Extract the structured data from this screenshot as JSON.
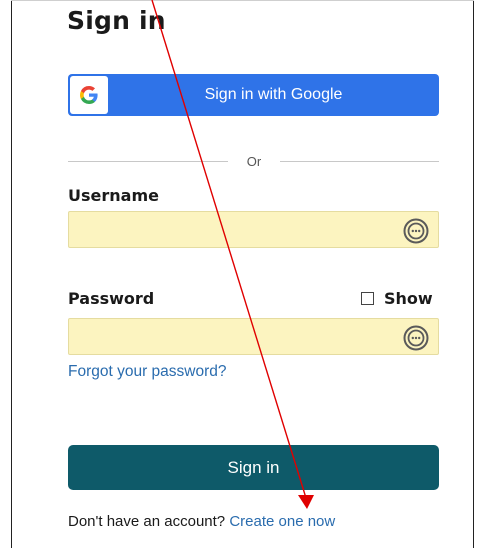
{
  "page": {
    "title": "Sign in"
  },
  "google": {
    "label": "Sign in with Google",
    "brand_color": "#2f73e8"
  },
  "divider": {
    "text": "Or"
  },
  "username": {
    "label": "Username",
    "value": "",
    "icon": "password-manager-icon"
  },
  "password": {
    "label": "Password",
    "value": "",
    "show_label": "Show",
    "show_checked": false,
    "icon": "password-manager-icon"
  },
  "links": {
    "forgot": "Forgot your password?"
  },
  "submit": {
    "label": "Sign in",
    "color": "#0e5a69"
  },
  "signup": {
    "prompt": "Don't have an account?",
    "link": "Create one now"
  },
  "annotation": {
    "type": "arrow",
    "color": "#e00000"
  }
}
